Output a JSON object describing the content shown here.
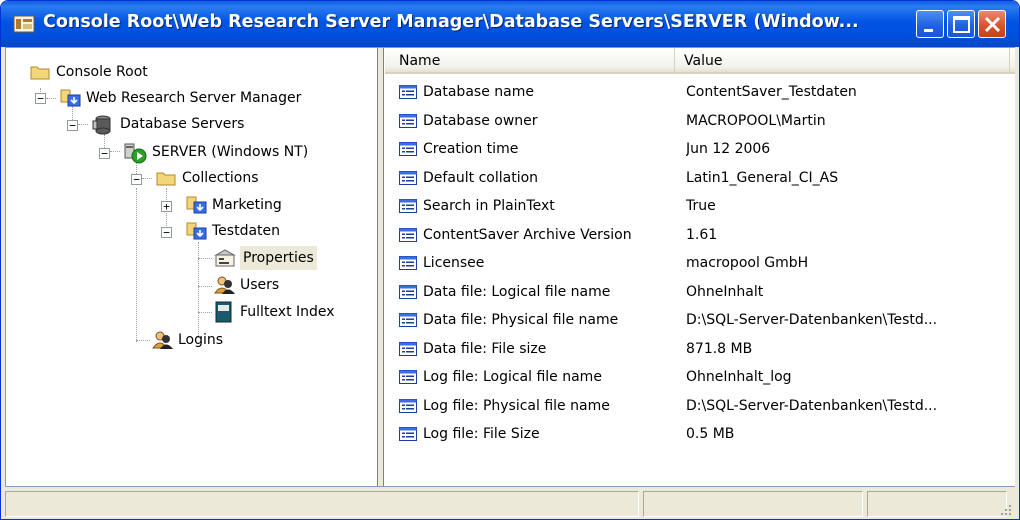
{
  "window": {
    "title": "Console Root\\Web Research Server Manager\\Database Servers\\SERVER (Window..."
  },
  "tree": {
    "nodes": [
      {
        "label": "Console Root",
        "icon": "folder-icon"
      },
      {
        "label": "Web Research Server Manager",
        "icon": "server-manager-icon"
      },
      {
        "label": "Database Servers",
        "icon": "database-icon"
      },
      {
        "label": "SERVER (Windows NT)",
        "icon": "server-running-icon"
      },
      {
        "label": "Collections",
        "icon": "folder-icon"
      },
      {
        "label": "Marketing",
        "icon": "collection-icon"
      },
      {
        "label": "Testdaten",
        "icon": "collection-icon"
      },
      {
        "label": "Properties",
        "icon": "properties-icon",
        "selected": true
      },
      {
        "label": "Users",
        "icon": "users-icon"
      },
      {
        "label": "Fulltext Index",
        "icon": "index-book-icon"
      },
      {
        "label": "Logins",
        "icon": "users-icon"
      }
    ]
  },
  "list": {
    "columns": {
      "name": "Name",
      "value": "Value"
    },
    "rows": [
      {
        "name": "Database name",
        "value": "ContentSaver_Testdaten"
      },
      {
        "name": "Database owner",
        "value": "MACROPOOL\\Martin"
      },
      {
        "name": "Creation time",
        "value": "Jun 12 2006"
      },
      {
        "name": "Default collation",
        "value": "Latin1_General_CI_AS"
      },
      {
        "name": "Search in PlainText",
        "value": "True"
      },
      {
        "name": "ContentSaver Archive Version",
        "value": "1.61"
      },
      {
        "name": "Licensee",
        "value": "macropool GmbH"
      },
      {
        "name": "Data file: Logical file name",
        "value": "OhneInhalt"
      },
      {
        "name": "Data file: Physical file name",
        "value": "D:\\SQL-Server-Datenbanken\\Testd..."
      },
      {
        "name": "Data file: File size",
        "value": "871.8 MB"
      },
      {
        "name": "Log file: Logical file name",
        "value": "OhneInhalt_log"
      },
      {
        "name": "Log file: Physical file name",
        "value": "D:\\SQL-Server-Datenbanken\\Testd..."
      },
      {
        "name": "Log file: File Size",
        "value": "0.5 MB"
      }
    ]
  },
  "colors": {
    "titlebar": "#0054e3",
    "close_button": "#d8502c",
    "window_face": "#ece9d8"
  }
}
